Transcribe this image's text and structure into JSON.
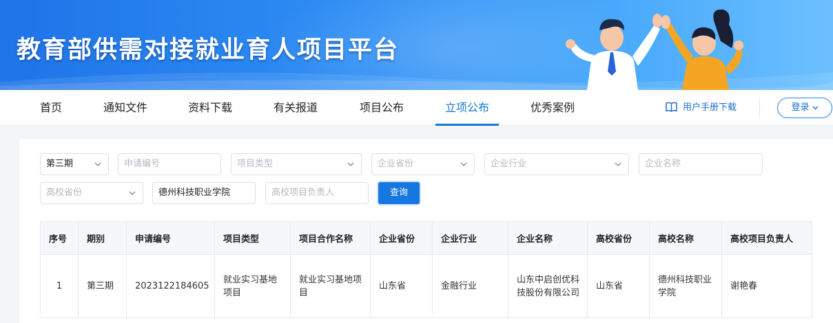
{
  "banner": {
    "title": "教育部供需对接就业育人项目平台"
  },
  "nav": {
    "items": [
      {
        "label": "首页"
      },
      {
        "label": "通知文件"
      },
      {
        "label": "资料下载"
      },
      {
        "label": "有关报道"
      },
      {
        "label": "项目公布"
      },
      {
        "label": "立项公布",
        "active": true
      },
      {
        "label": "优秀案例"
      }
    ],
    "manual_label": "用户手册下载",
    "manual_icon": "book-icon",
    "login_label": "登录"
  },
  "filters": {
    "period": {
      "value": "第三期"
    },
    "application_no": {
      "placeholder": "申请编号"
    },
    "project_type": {
      "placeholder": "项目类型"
    },
    "enterprise_province": {
      "placeholder": "企业省份"
    },
    "enterprise_industry": {
      "placeholder": "企业行业"
    },
    "enterprise_name": {
      "placeholder": "企业名称"
    },
    "school_province": {
      "placeholder": "高校省份"
    },
    "school_name": {
      "value": "德州科技职业学院"
    },
    "school_leader": {
      "placeholder": "高校项目负责人"
    },
    "query_label": "查询"
  },
  "table": {
    "headers": [
      "序号",
      "期别",
      "申请编号",
      "项目类型",
      "项目合作名称",
      "企业省份",
      "企业行业",
      "企业名称",
      "高校省份",
      "高校名称",
      "高校项目负责人"
    ],
    "rows": [
      [
        "1",
        "第三期",
        "2023122184605",
        "就业实习基地项目",
        "就业实习基地项目",
        "山东省",
        "金融行业",
        "山东中启创优科技股份有限公司",
        "山东省",
        "德州科技职业学院",
        "谢艳春"
      ]
    ]
  },
  "colors": {
    "accent": "#1677e0",
    "banner_start": "#1f74e8",
    "banner_end": "#6cc0ff"
  }
}
